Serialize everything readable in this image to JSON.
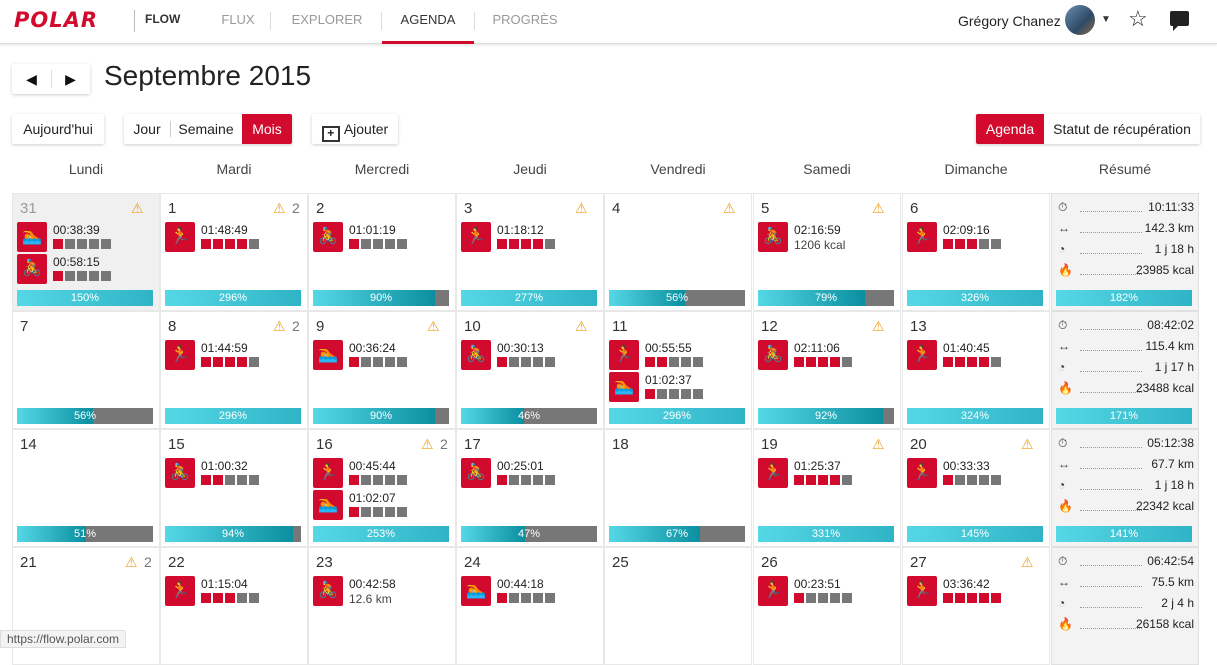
{
  "brand": {
    "logo": "POLAR",
    "product": "FLOW"
  },
  "nav": [
    {
      "label": "FLUX",
      "active": false
    },
    {
      "label": "EXPLORER",
      "active": false
    },
    {
      "label": "AGENDA",
      "active": true
    },
    {
      "label": "PROGRÈS",
      "active": false
    }
  ],
  "user": {
    "name": "Grégory Chanez",
    "avatar_icon": "user-avatar",
    "menu_icon": "caret-down-icon"
  },
  "header_icons": [
    "star-icon",
    "messages-icon"
  ],
  "calendar": {
    "title": "Septembre 2015",
    "prev_icon": "triangle-left-icon",
    "next_icon": "triangle-right-icon",
    "today_label": "Aujourd'hui",
    "views": [
      "Jour",
      "Semaine",
      "Mois"
    ],
    "active_view": "Mois",
    "add_label": "Ajouter",
    "modes": [
      "Agenda",
      "Statut de récupération"
    ],
    "active_mode": "Agenda",
    "day_headers": [
      "Lundi",
      "Mardi",
      "Mercredi",
      "Jeudi",
      "Vendredi",
      "Samedi",
      "Dimanche",
      "Résumé"
    ]
  },
  "colors": {
    "brand_red": "#d10a2e",
    "zone_grey": "#777777",
    "load_cyan": "#4fd3e3",
    "alert_orange": "#f0a020"
  },
  "weeks": [
    {
      "days": [
        {
          "date": "31",
          "prev_month": true,
          "alert": true,
          "alert_count": "",
          "activities": [
            {
              "sport": "swim",
              "time": "00:38:39",
              "zones": 1,
              "sub": ""
            },
            {
              "sport": "bike",
              "time": "00:58:15",
              "zones": 1,
              "sub": ""
            }
          ],
          "load": 150
        },
        {
          "date": "1",
          "alert": true,
          "alert_count": "2",
          "activities": [
            {
              "sport": "run",
              "time": "01:48:49",
              "zones": 4,
              "sub": ""
            }
          ],
          "load": 296
        },
        {
          "date": "2",
          "alert": false,
          "alert_count": "",
          "activities": [
            {
              "sport": "bike",
              "time": "01:01:19",
              "zones": 1,
              "sub": ""
            }
          ],
          "load": 90
        },
        {
          "date": "3",
          "alert": true,
          "alert_count": "",
          "activities": [
            {
              "sport": "run",
              "time": "01:18:12",
              "zones": 4,
              "sub": ""
            }
          ],
          "load": 277
        },
        {
          "date": "4",
          "alert": true,
          "alert_count": "",
          "activities": [],
          "load": 56
        },
        {
          "date": "5",
          "alert": true,
          "alert_count": "",
          "activities": [
            {
              "sport": "bike",
              "time": "02:16:59",
              "zones": 0,
              "sub": "1206 kcal"
            }
          ],
          "load": 79
        },
        {
          "date": "6",
          "alert": false,
          "alert_count": "",
          "activities": [
            {
              "sport": "run",
              "time": "02:09:16",
              "zones": 3,
              "sub": ""
            }
          ],
          "load": 326
        }
      ],
      "summary": {
        "duration": "10:11:33",
        "distance": "142.3 km",
        "recovery": "1 j 18 h",
        "calories": "23985 kcal",
        "load": 182
      }
    },
    {
      "days": [
        {
          "date": "7",
          "alert": false,
          "alert_count": "",
          "activities": [],
          "load": 56
        },
        {
          "date": "8",
          "alert": true,
          "alert_count": "2",
          "activities": [
            {
              "sport": "run",
              "time": "01:44:59",
              "zones": 4,
              "sub": ""
            }
          ],
          "load": 296
        },
        {
          "date": "9",
          "alert": true,
          "alert_count": "",
          "activities": [
            {
              "sport": "swim",
              "time": "00:36:24",
              "zones": 1,
              "sub": ""
            }
          ],
          "load": 90
        },
        {
          "date": "10",
          "alert": true,
          "alert_count": "",
          "activities": [
            {
              "sport": "bike",
              "time": "00:30:13",
              "zones": 1,
              "sub": ""
            }
          ],
          "load": 46
        },
        {
          "date": "11",
          "alert": false,
          "alert_count": "",
          "activities": [
            {
              "sport": "run",
              "time": "00:55:55",
              "zones": 2,
              "sub": ""
            },
            {
              "sport": "swim",
              "time": "01:02:37",
              "zones": 1,
              "sub": ""
            }
          ],
          "load": 296
        },
        {
          "date": "12",
          "alert": true,
          "alert_count": "",
          "activities": [
            {
              "sport": "bike",
              "time": "02:11:06",
              "zones": 4,
              "sub": ""
            }
          ],
          "load": 92
        },
        {
          "date": "13",
          "alert": false,
          "alert_count": "",
          "activities": [
            {
              "sport": "run",
              "time": "01:40:45",
              "zones": 4,
              "sub": ""
            }
          ],
          "load": 324
        }
      ],
      "summary": {
        "duration": "08:42:02",
        "distance": "115.4 km",
        "recovery": "1 j 17 h",
        "calories": "23488 kcal",
        "load": 171
      }
    },
    {
      "days": [
        {
          "date": "14",
          "alert": false,
          "alert_count": "",
          "activities": [],
          "load": 51
        },
        {
          "date": "15",
          "alert": false,
          "alert_count": "",
          "activities": [
            {
              "sport": "bike",
              "time": "01:00:32",
              "zones": 2,
              "sub": ""
            }
          ],
          "load": 94
        },
        {
          "date": "16",
          "alert": true,
          "alert_count": "2",
          "activities": [
            {
              "sport": "run",
              "time": "00:45:44",
              "zones": 1,
              "sub": ""
            },
            {
              "sport": "swim",
              "time": "01:02:07",
              "zones": 1,
              "sub": ""
            }
          ],
          "load": 253
        },
        {
          "date": "17",
          "alert": false,
          "alert_count": "",
          "activities": [
            {
              "sport": "bike",
              "time": "00:25:01",
              "zones": 1,
              "sub": ""
            }
          ],
          "load": 47
        },
        {
          "date": "18",
          "alert": false,
          "alert_count": "",
          "activities": [],
          "load": 67
        },
        {
          "date": "19",
          "alert": true,
          "alert_count": "",
          "activities": [
            {
              "sport": "run",
              "time": "01:25:37",
              "zones": 4,
              "sub": ""
            }
          ],
          "load": 331
        },
        {
          "date": "20",
          "alert": true,
          "alert_count": "",
          "activities": [
            {
              "sport": "run",
              "time": "00:33:33",
              "zones": 1,
              "sub": ""
            }
          ],
          "load": 145
        }
      ],
      "summary": {
        "duration": "05:12:38",
        "distance": "67.7 km",
        "recovery": "1 j 18 h",
        "calories": "22342 kcal",
        "load": 141
      }
    },
    {
      "days": [
        {
          "date": "21",
          "alert": true,
          "alert_count": "2",
          "activities": [],
          "load": 0
        },
        {
          "date": "22",
          "alert": false,
          "alert_count": "",
          "activities": [
            {
              "sport": "run",
              "time": "01:15:04",
              "zones": 3,
              "sub": ""
            }
          ],
          "load": 0
        },
        {
          "date": "23",
          "alert": false,
          "alert_count": "",
          "activities": [
            {
              "sport": "bike",
              "time": "00:42:58",
              "zones": 0,
              "sub": "12.6 km"
            }
          ],
          "load": 0
        },
        {
          "date": "24",
          "alert": false,
          "alert_count": "",
          "activities": [
            {
              "sport": "swim",
              "time": "00:44:18",
              "zones": 1,
              "sub": ""
            }
          ],
          "load": 0
        },
        {
          "date": "25",
          "alert": false,
          "alert_count": "",
          "activities": [],
          "load": 0
        },
        {
          "date": "26",
          "alert": false,
          "alert_count": "",
          "activities": [
            {
              "sport": "run",
              "time": "00:23:51",
              "zones": 1,
              "sub": ""
            }
          ],
          "load": 0
        },
        {
          "date": "27",
          "alert": true,
          "alert_count": "",
          "activities": [
            {
              "sport": "run",
              "time": "03:36:42",
              "zones": 5,
              "sub": ""
            }
          ],
          "load": 0
        }
      ],
      "summary": {
        "duration": "06:42:54",
        "distance": "75.5 km",
        "recovery": "2 j 4 h",
        "calories": "26158 kcal",
        "load": 0
      }
    }
  ],
  "status_url": "https://flow.polar.com"
}
